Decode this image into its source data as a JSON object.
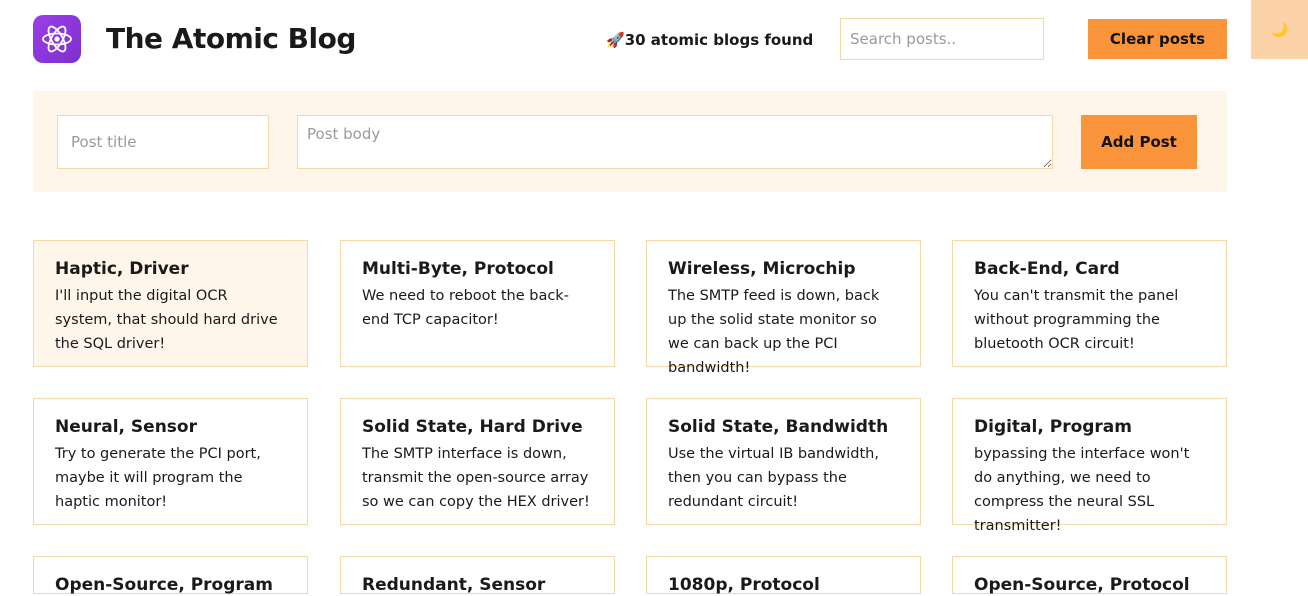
{
  "header": {
    "title": "The Atomic Blog",
    "results_icon": "🚀",
    "results_text": "30 atomic blogs found",
    "search_placeholder": "Search posts..",
    "clear_label": "Clear posts",
    "theme_icon": "🌙",
    "logo_icon": "atom-icon"
  },
  "form": {
    "title_placeholder": "Post title",
    "body_placeholder": "Post body",
    "add_label": "Add Post"
  },
  "colors": {
    "accent": "#f9943b",
    "panel": "#fef5eb",
    "border": "#f6d7a7",
    "logo": "#8a35dc"
  },
  "posts": [
    {
      "title": "Haptic, Driver",
      "body": "I'll input the digital OCR system, that should hard drive the SQL driver!"
    },
    {
      "title": "Multi-Byte, Protocol",
      "body": "We need to reboot the back-end TCP capacitor!"
    },
    {
      "title": "Wireless, Microchip",
      "body": "The SMTP feed is down, back up the solid state monitor so we can back up the PCI bandwidth!"
    },
    {
      "title": "Back-End, Card",
      "body": "You can't transmit the panel without programming the bluetooth OCR circuit!"
    },
    {
      "title": "Neural, Sensor",
      "body": "Try to generate the PCI port, maybe it will program the haptic monitor!"
    },
    {
      "title": "Solid State, Hard Drive",
      "body": "The SMTP interface is down, transmit the open-source array so we can copy the HEX driver!"
    },
    {
      "title": "Solid State, Bandwidth",
      "body": "Use the virtual IB bandwidth, then you can bypass the redundant circuit!"
    },
    {
      "title": "Digital, Program",
      "body": "bypassing the interface won't do anything, we need to compress the neural SSL transmitter!"
    },
    {
      "title": "Open-Source, Program",
      "body": ""
    },
    {
      "title": "Redundant, Sensor",
      "body": ""
    },
    {
      "title": "1080p, Protocol",
      "body": ""
    },
    {
      "title": "Open-Source, Protocol",
      "body": ""
    }
  ]
}
